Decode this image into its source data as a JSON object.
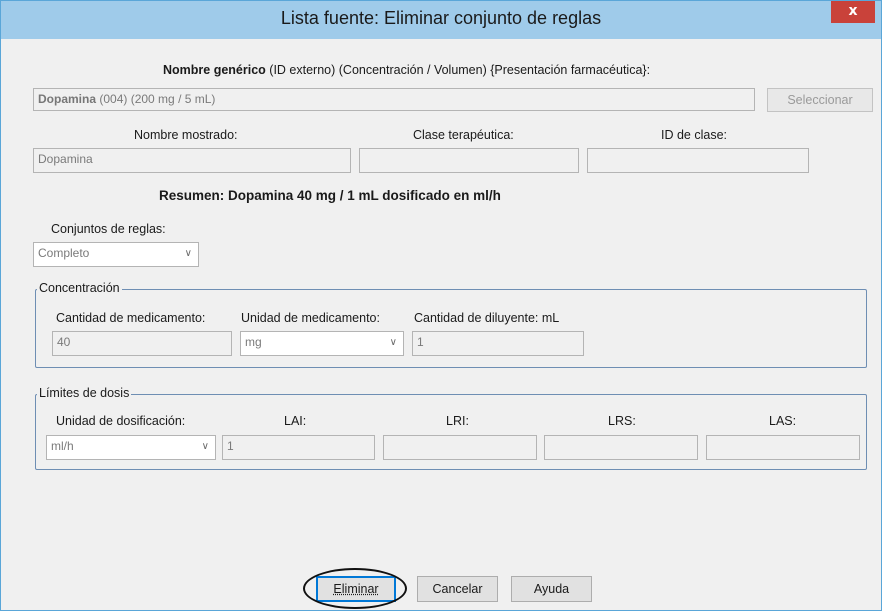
{
  "window": {
    "title": "Lista fuente: Eliminar conjunto de reglas",
    "close_glyph": "x"
  },
  "generic": {
    "header_bold": "Nombre genérico",
    "header_rest": "(ID externo) (Concentración / Volumen) {Presentación farmacéutica}:",
    "value_bold": "Dopamina",
    "value_rest": "(004) (200 mg / 5 mL)",
    "select_label": "Seleccionar"
  },
  "display": {
    "name_label": "Nombre mostrado:",
    "name_value": "Dopamina",
    "class_label": "Clase terapéutica:",
    "class_value": "",
    "class_id_label": "ID de clase:",
    "class_id_value": ""
  },
  "summary": "Resumen: Dopamina 40 mg / 1 mL dosificado en ml/h",
  "rule_sets": {
    "label": "Conjuntos de reglas:",
    "value": "Completo"
  },
  "concentration": {
    "legend": "Concentración",
    "amount_label": "Cantidad de medicamento:",
    "amount_value": "40",
    "unit_label": "Unidad de medicamento:",
    "unit_value": "mg",
    "diluent_label": "Cantidad de diluyente: mL",
    "diluent_value": "1"
  },
  "dose_limits": {
    "legend": "Límites de dosis",
    "unit_label": "Unidad de dosificación:",
    "unit_value": "ml/h",
    "value_1": "1",
    "lai_label": "LAI:",
    "lri_label": "LRI:",
    "lrs_label": "LRS:",
    "las_label": "LAS:",
    "lai_value": "",
    "lri_value": "",
    "lrs_value": "",
    "las_value": ""
  },
  "buttons": {
    "delete": "Eliminar",
    "cancel": "Cancelar",
    "help": "Ayuda"
  },
  "icons": {
    "dropdown": "chevron-down-icon",
    "close": "close-icon"
  },
  "colors": {
    "titlebar": "#9fcbea",
    "close": "#c9423a",
    "group_border": "#6e8eb3"
  }
}
